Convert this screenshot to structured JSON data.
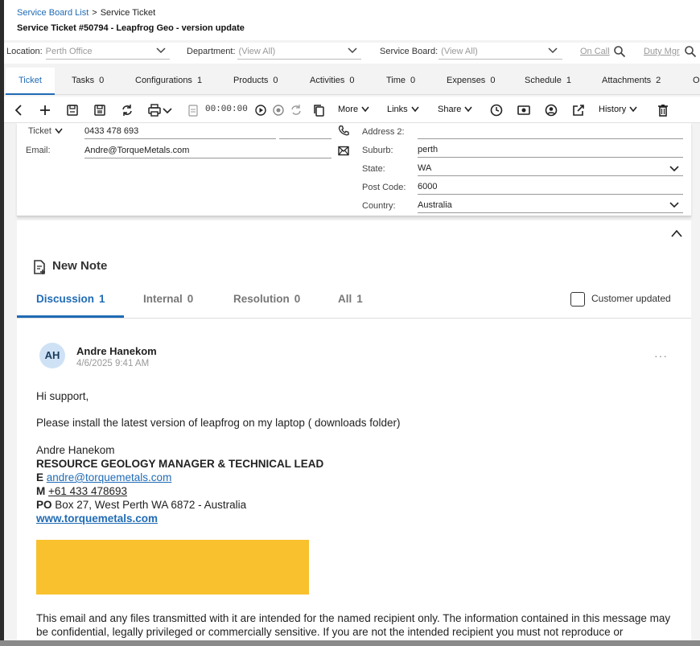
{
  "breadcrumb": {
    "parent": "Service Board List",
    "current": "Service Ticket"
  },
  "page_title": "Service Ticket #50794 - Leapfrog Geo - version update",
  "filters": {
    "location_label": "Location:",
    "location_value": "Perth Office",
    "department_label": "Department:",
    "department_value": "(View All)",
    "board_label": "Service Board:",
    "board_value": "(View All)",
    "on_call": "On Call",
    "duty_mgr": "Duty Mgr"
  },
  "tabs": [
    {
      "label": "Ticket",
      "count": ""
    },
    {
      "label": "Tasks",
      "count": "0"
    },
    {
      "label": "Configurations",
      "count": "1"
    },
    {
      "label": "Products",
      "count": "0"
    },
    {
      "label": "Activities",
      "count": "0"
    },
    {
      "label": "Time",
      "count": "0"
    },
    {
      "label": "Expenses",
      "count": "0"
    },
    {
      "label": "Schedule",
      "count": "1"
    },
    {
      "label": "Attachments",
      "count": "2"
    },
    {
      "label": "O",
      "count": ""
    }
  ],
  "toolbar": {
    "timer": "00:00:00",
    "more": "More",
    "links": "Links",
    "share": "Share",
    "history": "History"
  },
  "contact": {
    "phone_type": "Ticket",
    "phone": "0433 478 693",
    "email_label": "Email:",
    "email": "Andre@TorqueMetals.com",
    "address2_label": "Address 2:",
    "address2": "",
    "suburb_label": "Suburb:",
    "suburb": "perth",
    "state_label": "State:",
    "state": "WA",
    "postcode_label": "Post Code:",
    "postcode": "6000",
    "country_label": "Country:",
    "country": "Australia"
  },
  "notes": {
    "new_note": "New Note",
    "tabs": [
      {
        "label": "Discussion",
        "count": "1"
      },
      {
        "label": "Internal",
        "count": "0"
      },
      {
        "label": "Resolution",
        "count": "0"
      },
      {
        "label": "All",
        "count": "1"
      }
    ],
    "customer_updated": "Customer updated",
    "note": {
      "initials": "AH",
      "author": "Andre Hanekom",
      "date": "4/6/2025 9:41 AM",
      "greeting": "Hi support,",
      "message": "Please install the latest version of leapfrog on my laptop ( downloads folder)",
      "sig_name": "Andre Hanekom",
      "sig_role": "RESOURCE GEOLOGY MANAGER & TECHNICAL LEAD",
      "sig_e_label": "E",
      "sig_email": "andre@torquemetals.com",
      "sig_m_label": "M",
      "sig_mobile": "+61 433 478693",
      "sig_po_label": "PO",
      "sig_po": "Box 27, West Perth WA 6872 - Australia",
      "sig_web": "www.torquemetals.com",
      "disclaimer": "This email and any files transmitted with it are intended for the named recipient only. The information contained in this message may be confidential, legally privileged or commercially sensitive. If you are not the intended recipient you must not reproduce or"
    }
  },
  "colors": {
    "accent": "#1f6bb5",
    "banner": "#f8c12d"
  }
}
